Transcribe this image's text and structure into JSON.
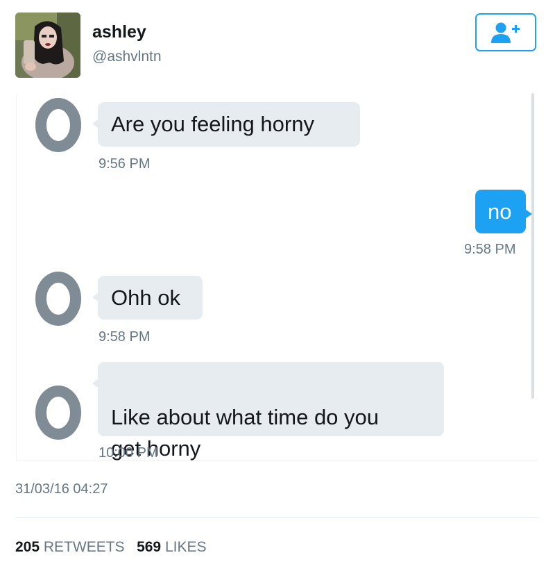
{
  "user": {
    "name": "ashley",
    "handle": "@ashvlntn"
  },
  "follow_button": {
    "icon": "add-user-icon"
  },
  "messages": [
    {
      "text": "Are you feeling horny",
      "time": "9:56 PM",
      "direction": "received"
    },
    {
      "text": "no",
      "time": "9:58 PM",
      "direction": "sent"
    },
    {
      "text": "Ohh ok",
      "time": "9:58 PM",
      "direction": "received"
    },
    {
      "text": "Like about what time do you\nget horny",
      "time": "10:00 PM",
      "direction": "received"
    }
  ],
  "tweet": {
    "date": "31/03/16 04:27",
    "retweets_count": "205",
    "retweets_label": "RETWEETS",
    "likes_count": "569",
    "likes_label": "LIKES"
  },
  "colors": {
    "accent": "#1da1f2",
    "bubble_received": "#e6ecf0",
    "avatar_ring": "#7f8b95",
    "muted_text": "#657786"
  }
}
